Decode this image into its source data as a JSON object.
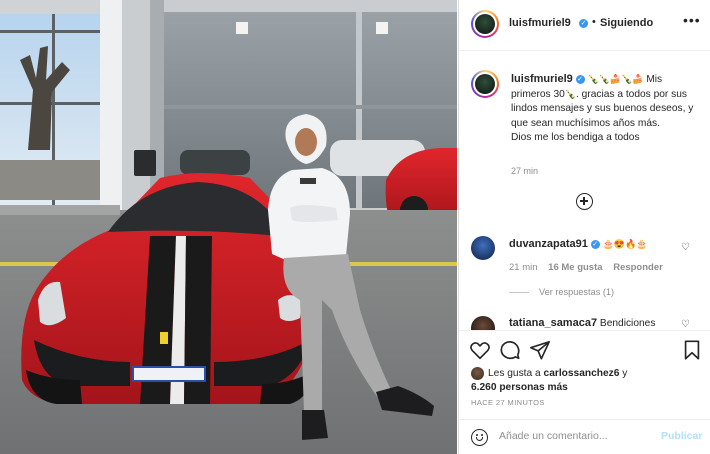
{
  "post": {
    "username": "luisfmuriel9",
    "separator": "•",
    "follow_status": "Siguiendo",
    "more_icon": "more-horizontal-icon",
    "caption_emojis": "🍾🍾🍰🍾🍰",
    "caption_lead": "Mis primeros 30",
    "caption_emojis_2": "🍾",
    "caption_body": ". gracias a todos por sus lindos mensajes y sus buenos deseos, y que sean muchísimos años más.",
    "caption_line2": "Dios me los bendiga a todos",
    "caption_time": "27 min"
  },
  "comments": [
    {
      "username": "duvanzapata91",
      "emojis": "🎂😍🔥🎂",
      "time": "21 min",
      "likes": "16 Me gusta",
      "reply": "Responder",
      "view_replies": "Ver respuestas (1)"
    },
    {
      "username": "tatiana_samaca7",
      "text": "Bendiciones"
    }
  ],
  "actions": {
    "likes_prefix": "Les gusta a",
    "likes_user": "carlossanchez6",
    "likes_conj": "y",
    "likes_count": "6.260 personas más",
    "posted_time": "HACE 27 MINUTOS"
  },
  "composer": {
    "placeholder": "Añade un comentario...",
    "publish": "Publicar"
  },
  "colors": {
    "verified": "#3897f0",
    "publish_disabled": "#b2dffc",
    "ferrari_red": "#d01f26"
  }
}
